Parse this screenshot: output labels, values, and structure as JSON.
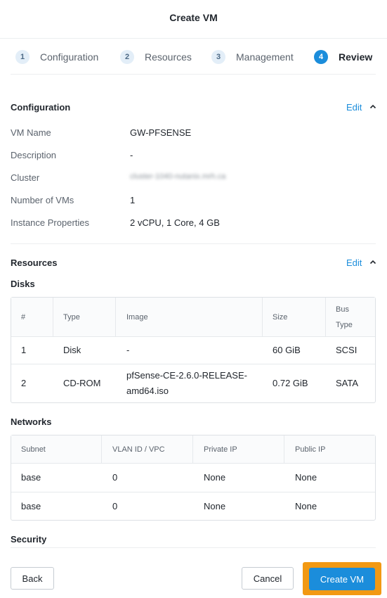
{
  "dialog": {
    "title": "Create VM"
  },
  "steps": [
    {
      "number": "1",
      "label": "Configuration"
    },
    {
      "number": "2",
      "label": "Resources"
    },
    {
      "number": "3",
      "label": "Management"
    },
    {
      "number": "4",
      "label": "Review"
    }
  ],
  "configuration": {
    "title": "Configuration",
    "edit_label": "Edit",
    "fields": [
      {
        "label": "VM Name",
        "value": "GW-PFSENSE"
      },
      {
        "label": "Description",
        "value": "-"
      },
      {
        "label": "Cluster",
        "value": "cluster-1040-nutanix.mrh.ca"
      },
      {
        "label": "Number of VMs",
        "value": "1"
      },
      {
        "label": "Instance Properties",
        "value": "2 vCPU, 1 Core, 4 GB"
      }
    ]
  },
  "resources": {
    "title": "Resources",
    "edit_label": "Edit",
    "disks": {
      "title": "Disks",
      "headers": {
        "num": "#",
        "type": "Type",
        "image": "Image",
        "size": "Size",
        "bus_line1": "Bus",
        "bus_line2": "Type"
      },
      "rows": [
        {
          "num": "1",
          "type": "Disk",
          "image_line1": "-",
          "image_line2": "",
          "size": "60 GiB",
          "bus": "SCSI"
        },
        {
          "num": "2",
          "type": "CD-ROM",
          "image_line1": "pfSense-CE-2.6.0-RELEASE-",
          "image_line2": "amd64.iso",
          "size": "0.72 GiB",
          "bus": "SATA"
        }
      ]
    },
    "networks": {
      "title": "Networks",
      "headers": {
        "subnet": "Subnet",
        "vlan": "VLAN ID / VPC",
        "private_ip": "Private IP",
        "public_ip": "Public IP"
      },
      "rows": [
        {
          "subnet": "base",
          "vlan": "0",
          "private_ip": "None",
          "public_ip": "None"
        },
        {
          "subnet": "base",
          "vlan": "0",
          "private_ip": "None",
          "public_ip": "None"
        }
      ]
    },
    "security": {
      "title": "Security"
    }
  },
  "footer": {
    "back_label": "Back",
    "cancel_label": "Cancel",
    "create_label": "Create VM"
  },
  "colors": {
    "accent": "#1b8ddb",
    "highlight": "#f29913"
  }
}
